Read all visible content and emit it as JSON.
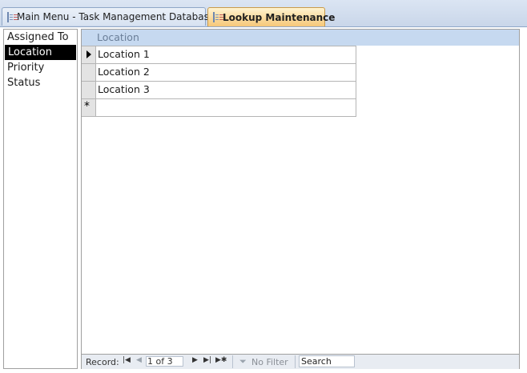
{
  "tabs": [
    {
      "label": "Main Menu - Task Management Database",
      "icon": "form-icon",
      "active": false
    },
    {
      "label": "Lookup Maintenance",
      "icon": "form-icon",
      "active": true
    }
  ],
  "lookup_list": {
    "items": [
      {
        "label": "Assigned To",
        "selected": false
      },
      {
        "label": "Location",
        "selected": true
      },
      {
        "label": "Priority",
        "selected": false
      },
      {
        "label": "Status",
        "selected": false
      }
    ]
  },
  "datasheet": {
    "header": "Location",
    "rows": [
      {
        "value": "Location 1",
        "current": true
      },
      {
        "value": "Location 2",
        "current": false
      },
      {
        "value": "Location 3",
        "current": false
      }
    ],
    "new_row_marker": "*"
  },
  "navigation": {
    "record_label": "Record:",
    "position": "1 of 3",
    "filter_label": "No Filter",
    "search_label": "Search"
  },
  "colors": {
    "header_band": "#c6d9f0",
    "active_tab": "#f6c778",
    "selected_item": "#000000"
  }
}
